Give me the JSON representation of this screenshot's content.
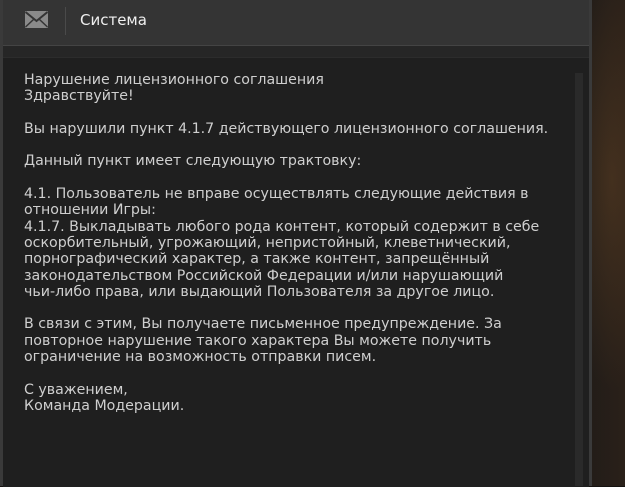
{
  "header": {
    "icon": "mail-icon",
    "title": "Система"
  },
  "message": {
    "subject": "Нарушение лицензионного соглашения",
    "greeting": "Здравствуйте!",
    "violation": "Вы нарушили пункт 4.1.7 действующего лицензионного соглашения.",
    "interpretation_intro": "Данный пункт имеет следующую трактовку:",
    "clause_lines": [
      "4.1. Пользователь не вправе осуществлять следующие действия в",
      "отношении Игры:",
      "4.1.7. Выкладывать любого рода контент, который содержит в себе",
      "оскорбительный, угрожающий, непристойный, клеветнический,",
      "порнографический характер, а также контент, запрещённый",
      "законодательством Российской Федерации и/или нарушающий",
      "чьи-либо права, или выдающий Пользователя за другое лицо."
    ],
    "warning_lines": [
      "В связи с этим, Вы получаете письменное предупреждение. За",
      "повторное нарушение такого характера Вы можете получить",
      "ограничение на возможность отправки писем."
    ],
    "closing": "С уважением,",
    "signature": "Команда Модерации."
  },
  "colors": {
    "header_bg": "#343434",
    "panel_bg": "#1f1f1f",
    "text": "#cfcfcf",
    "title_text": "#f0f0f0"
  }
}
